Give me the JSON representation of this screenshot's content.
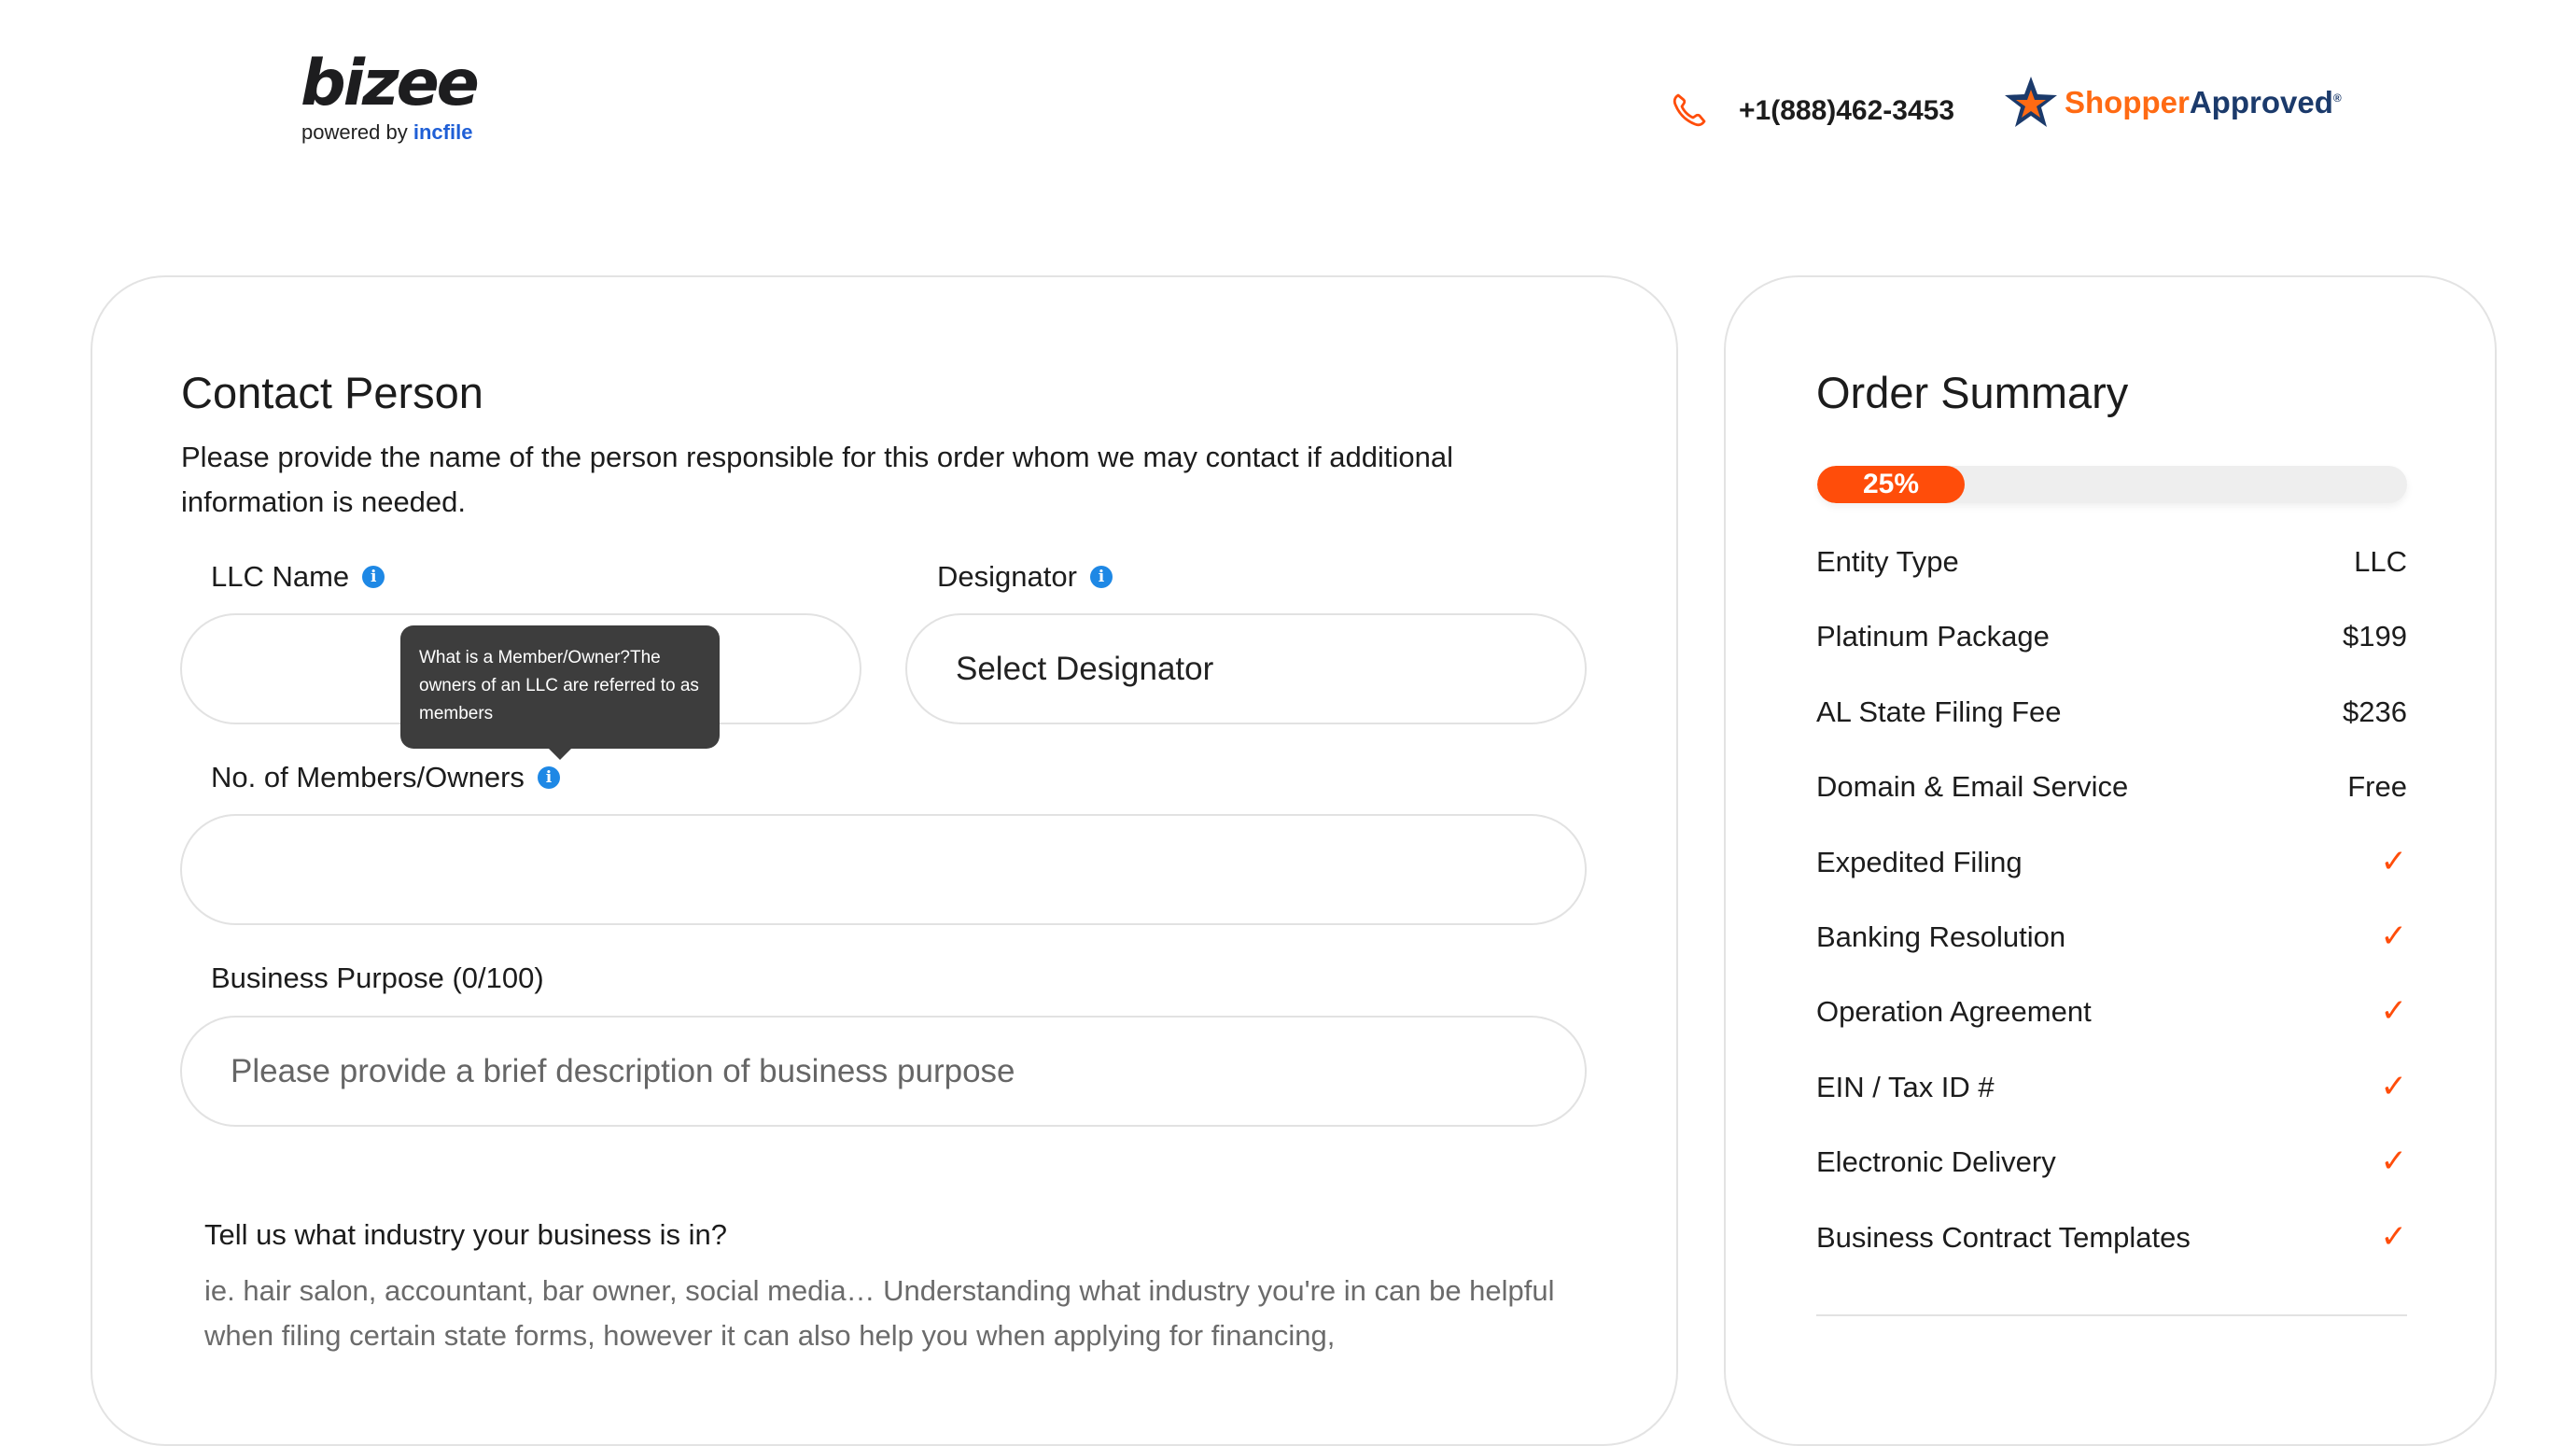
{
  "brand": {
    "logo_text": "bizee",
    "tagline_prefix": "powered by",
    "tagline_brand": "incfile"
  },
  "header": {
    "phone": "+1(888)462-3453",
    "shopper_part1": "Shopper",
    "shopper_part2": "Approved",
    "shopper_reg": "®"
  },
  "contact": {
    "title": "Contact Person",
    "description": "Please provide the name of the person responsible for this order whom we may contact if additional information is needed.",
    "llc_name_label": "LLC Name",
    "llc_name_value": "",
    "designator_label": "Designator",
    "designator_value": "Select Designator",
    "members_label": "No. of Members/Owners",
    "members_value": "",
    "purpose_label": "Business Purpose (0/100)",
    "purpose_placeholder": "Please provide a brief description of business purpose",
    "tooltip": "What is a Member/Owner?The owners of an LLC are referred to as members",
    "industry_question": "Tell us what industry your business is in?",
    "industry_hint": "ie. hair salon, accountant, bar owner, social media… Understanding what industry you're in can be helpful when filing certain state forms, however it can also help you when applying for financing,"
  },
  "order": {
    "title": "Order Summary",
    "progress_label": "25%",
    "progress_value": 0.25,
    "items": [
      {
        "label": "Entity Type",
        "value": "LLC"
      },
      {
        "label": "Platinum Package",
        "value": "$199"
      },
      {
        "label": "AL State Filing Fee",
        "value": "$236"
      },
      {
        "label": "Domain & Email Service",
        "value": "Free"
      },
      {
        "label": "Expedited Filing",
        "value": "✓"
      },
      {
        "label": "Banking Resolution",
        "value": "✓"
      },
      {
        "label": "Operation Agreement",
        "value": "✓"
      },
      {
        "label": "EIN / Tax ID #",
        "value": "✓"
      },
      {
        "label": "Electronic Delivery",
        "value": "✓"
      },
      {
        "label": "Business Contract Templates",
        "value": "✓"
      }
    ]
  },
  "colors": {
    "accent": "#ff4d0a",
    "info_blue": "#1e88e5",
    "shopper_orange": "#ff6a13",
    "shopper_navy": "#1b3a6b"
  },
  "icons": {
    "phone": "phone-icon",
    "info": "info-icon",
    "check": "checkmark-icon",
    "star": "shopper-approved-star-icon"
  }
}
